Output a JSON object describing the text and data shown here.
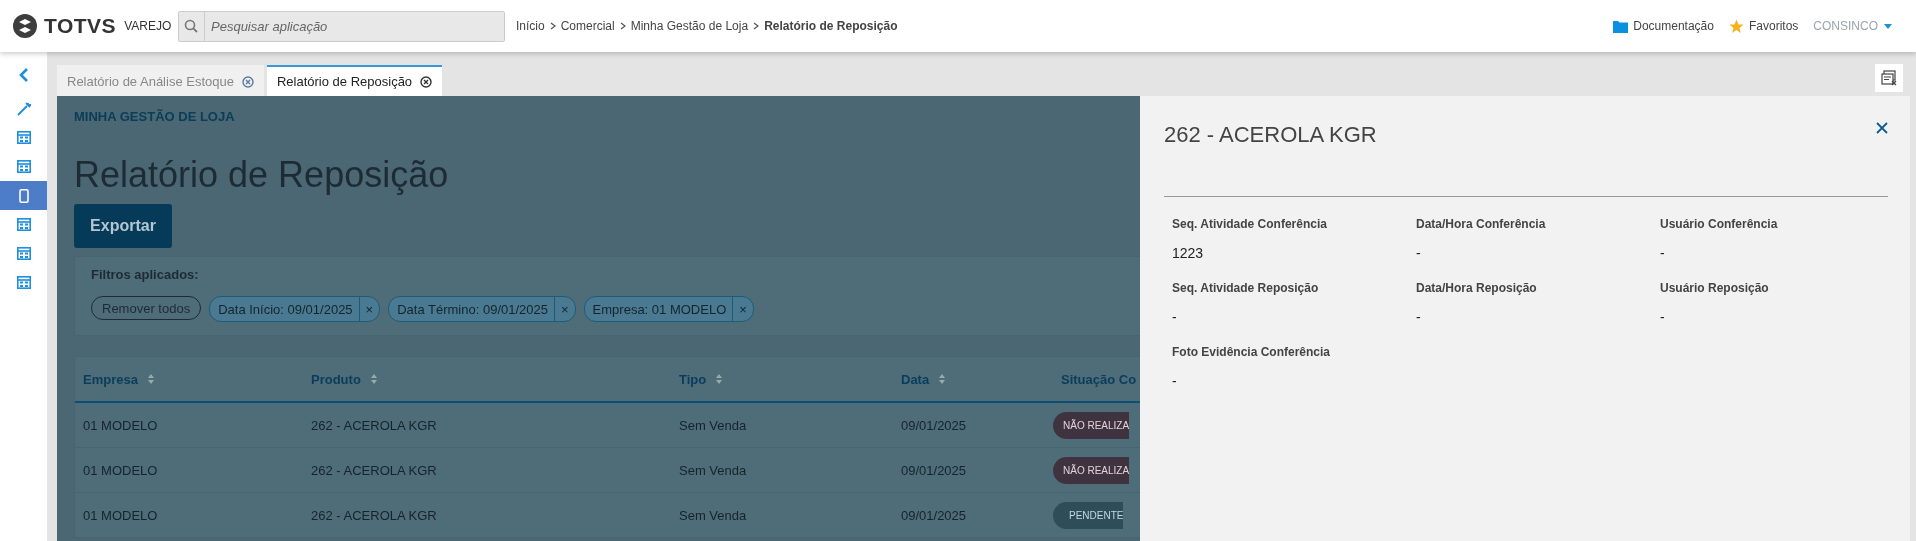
{
  "header": {
    "brand": "TOTVS",
    "brand_sub": "VAREJO",
    "search": {
      "placeholder": "Pesquisar aplicação"
    },
    "breadcrumb": [
      {
        "label": "Início",
        "current": false
      },
      {
        "label": "Comercial",
        "current": false
      },
      {
        "label": "Minha Gestão de Loja",
        "current": false
      },
      {
        "label": "Relatório de Reposição",
        "current": true
      }
    ],
    "links": [
      "Documentação",
      "Favoritos"
    ],
    "user": "CONSINCO"
  },
  "sidebar": {
    "items": [
      {
        "kind": "tool",
        "selected": false
      },
      {
        "kind": "grid",
        "selected": false
      },
      {
        "kind": "grid",
        "selected": false
      },
      {
        "kind": "mobile",
        "selected": true
      },
      {
        "kind": "grid",
        "selected": false
      },
      {
        "kind": "grid",
        "selected": false
      },
      {
        "kind": "grid",
        "selected": false
      }
    ]
  },
  "tabs": [
    {
      "label": "Relatório de Análise Estoque",
      "selected": false
    },
    {
      "label": "Relatório de Reposição",
      "selected": true
    }
  ],
  "page": {
    "section": "MINHA GESTÃO DE LOJA",
    "title": "Relatório de Reposição",
    "export_button": "Exportar",
    "filters": {
      "label": "Filtros aplicados:",
      "remove_all": "Remover todos",
      "chips": [
        "Data Início: 09/01/2025",
        "Data Término: 09/01/2025",
        "Empresa: 01 MODELO"
      ],
      "chip_close": "×"
    }
  },
  "table": {
    "columns": [
      "Empresa",
      "Produto",
      "Tipo",
      "Data",
      "Situação Co"
    ],
    "rows": [
      {
        "cells": [
          "01 MODELO",
          "262 - ACEROLA KGR",
          "Sem Venda",
          "09/01/2025"
        ],
        "status": {
          "text": "NÃO REALIZA",
          "kind": "danger"
        }
      },
      {
        "cells": [
          "01 MODELO",
          "262 - ACEROLA KGR",
          "Sem Venda",
          "09/01/2025"
        ],
        "status": {
          "text": "NÃO REALIZA",
          "kind": "danger"
        }
      },
      {
        "cells": [
          "01 MODELO",
          "262 - ACEROLA KGR",
          "Sem Venda",
          "09/01/2025"
        ],
        "status": {
          "text": "PENDENTE",
          "kind": "pending"
        }
      }
    ]
  },
  "detail_panel": {
    "title": "262 - ACEROLA KGR",
    "fields": [
      {
        "label": "Seq. Atividade Conferência",
        "value": "1223"
      },
      {
        "label": "Data/Hora Conferência",
        "value": "-"
      },
      {
        "label": "Usuário Conferência",
        "value": "-"
      },
      {
        "label": "Seq. Atividade Reposição",
        "value": "-"
      },
      {
        "label": "Data/Hora Reposição",
        "value": "-"
      },
      {
        "label": "Usuário Reposição",
        "value": "-"
      },
      {
        "label": "Foto Evidência Conferência",
        "value": "-"
      }
    ]
  }
}
